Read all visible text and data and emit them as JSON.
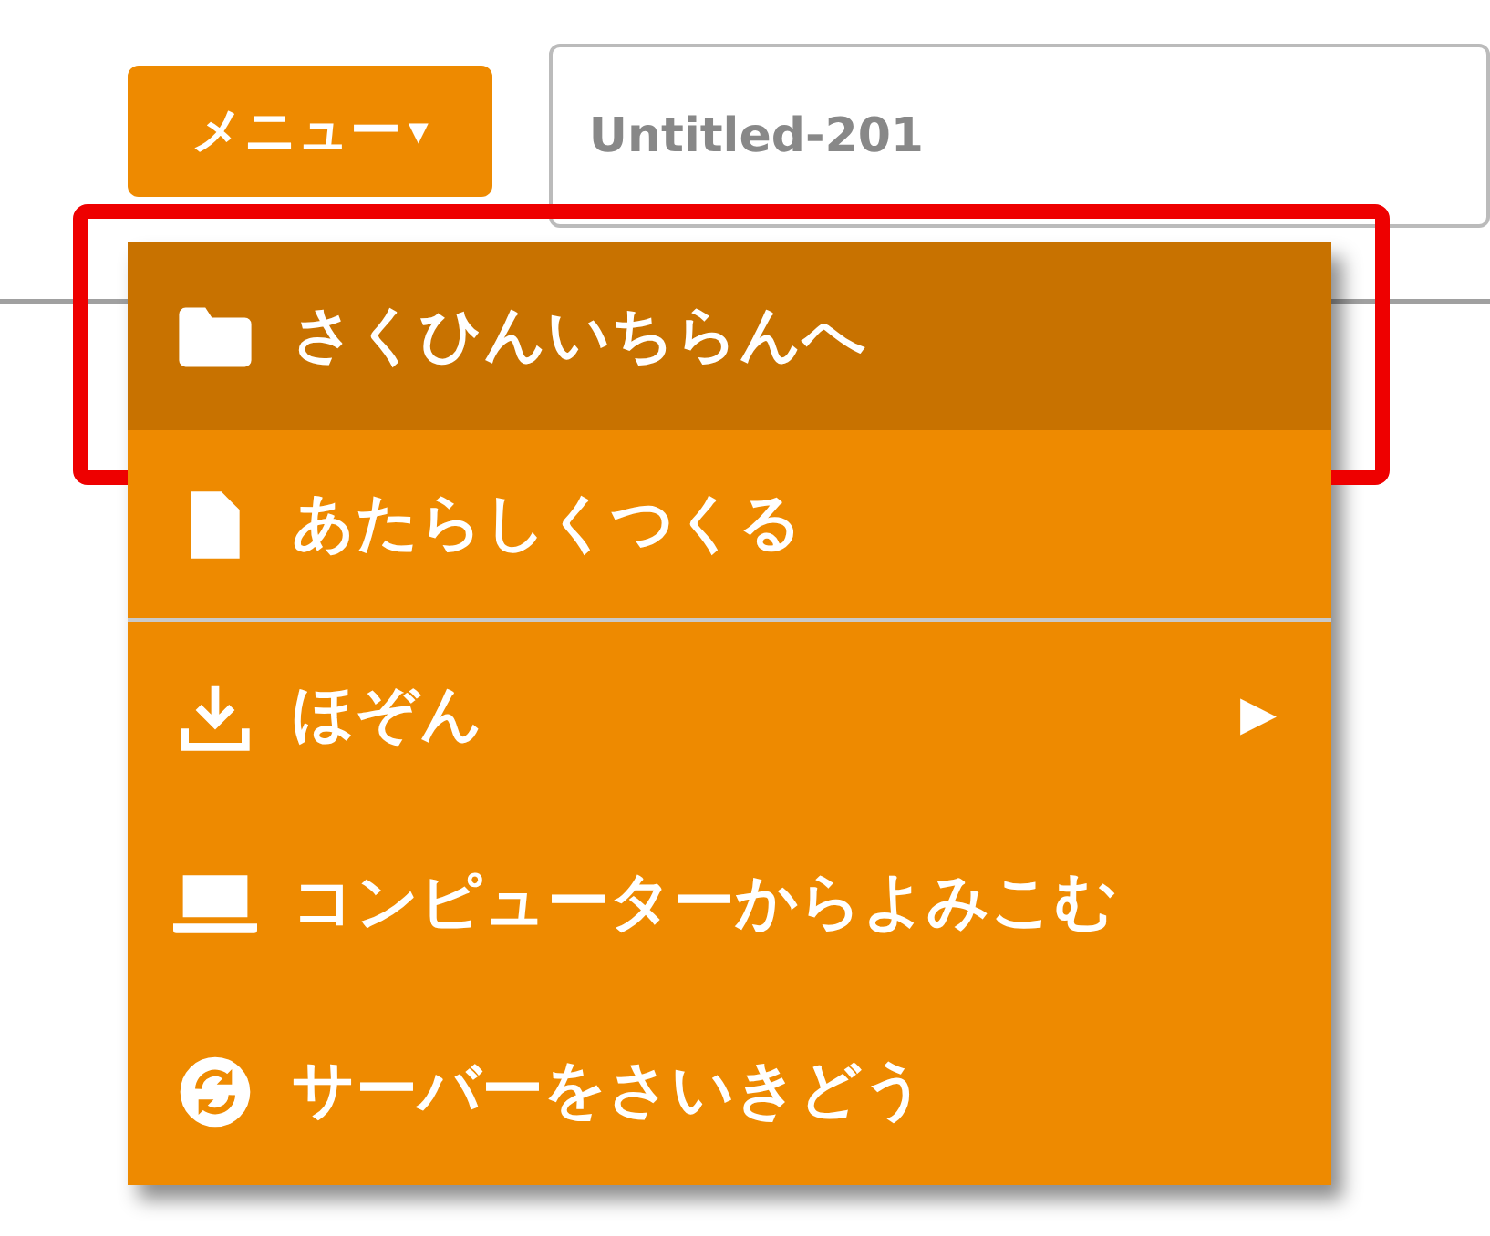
{
  "menu_button": {
    "label": "メニュー",
    "caret": "▾"
  },
  "title_field": {
    "placeholder": "Untitled-201"
  },
  "menu": {
    "items": [
      {
        "label": "さくひんいちらんへ",
        "selected": true,
        "highlighted": true,
        "separator_after": false
      },
      {
        "label": "あたらしくつくる",
        "selected": false,
        "highlighted": false,
        "separator_after": true
      },
      {
        "label": "ほぞん",
        "selected": false,
        "highlighted": false,
        "separator_after": false,
        "submenu_arrow": "▶"
      },
      {
        "label": "コンピューターからよみこむ",
        "selected": false,
        "highlighted": false,
        "separator_after": false
      },
      {
        "label": "サーバーをさいきどう",
        "selected": false,
        "highlighted": false,
        "separator_after": false
      }
    ]
  }
}
